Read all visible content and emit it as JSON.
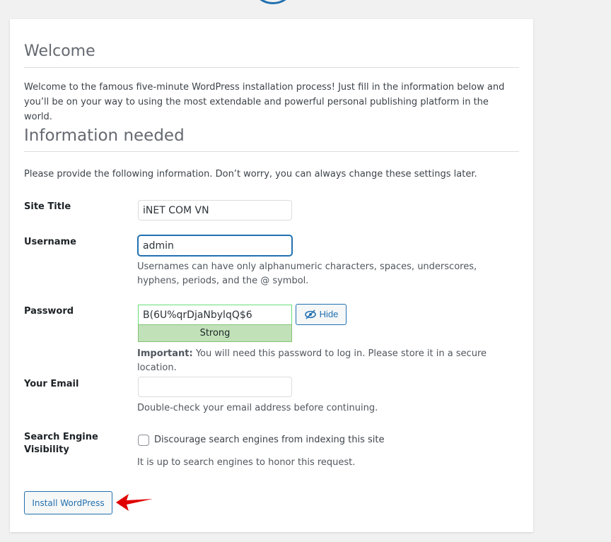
{
  "welcome": {
    "title": "Welcome",
    "intro": "Welcome to the famous five-minute WordPress installation process! Just fill in the information below and you’ll be on your way to using the most extendable and powerful personal publishing platform in the world."
  },
  "info": {
    "title": "Information needed",
    "provide": "Please provide the following information. Don’t worry, you can always change these settings later."
  },
  "form": {
    "site_title": {
      "label": "Site Title",
      "value": "iNET COM VN"
    },
    "username": {
      "label": "Username",
      "value": "admin",
      "hint": "Usernames can have only alphanumeric characters, spaces, underscores, hyphens, periods, and the @ symbol."
    },
    "password": {
      "label": "Password",
      "value": "B(6U%qrDjaNbylqQ$6",
      "strength": "Strong",
      "hide_label": "Hide",
      "important_bold": "Important:",
      "important_text": " You will need this password to log in. Please store it in a secure location."
    },
    "email": {
      "label": "Your Email",
      "value": "",
      "hint": "Double-check your email address before continuing."
    },
    "visibility": {
      "label": "Search Engine Visibility",
      "checkbox_label": "Discourage search engines from indexing this site",
      "checked": false,
      "hint": "It is up to search engines to honor this request."
    }
  },
  "install_button": "Install WordPress",
  "colors": {
    "accent": "#2271b1",
    "strength_bg": "#c1e1b9",
    "arrow": "#e00000"
  },
  "icons": {
    "hide": "eye-slash-icon",
    "arrow": "red-arrow-icon"
  }
}
